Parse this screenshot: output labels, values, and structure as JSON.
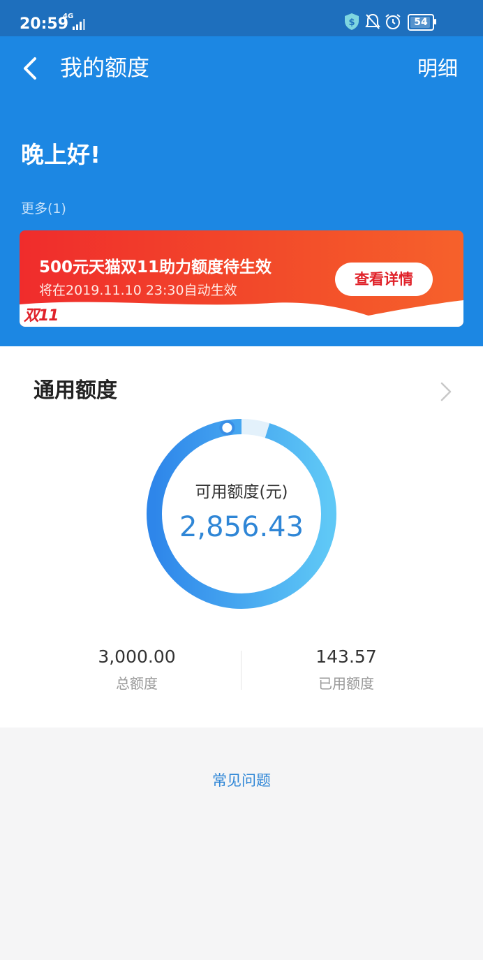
{
  "status_bar": {
    "time": "20:59",
    "network": "4G",
    "battery": "54"
  },
  "header": {
    "title": "我的额度",
    "detail_link": "明细",
    "greeting": "晚上好!",
    "more": "更多(1)"
  },
  "promo": {
    "title": "500元天猫双11助力额度待生效",
    "subtitle": "将在2019.11.10 23:30自动生效",
    "button": "查看详情",
    "logo": "双11"
  },
  "quota": {
    "section_title": "通用额度",
    "available_label": "可用额度(元)",
    "available_value": "2,856.43",
    "total_value": "3,000.00",
    "total_label": "总额度",
    "used_value": "143.57",
    "used_label": "已用额度",
    "used_fraction": 0.0479
  },
  "footer": {
    "faq": "常见问题"
  },
  "colors": {
    "status_bg": "#1e6fbd",
    "header_bg": "#1c87e3",
    "accent": "#2f86d6",
    "promo_red": "#f02c2c"
  }
}
